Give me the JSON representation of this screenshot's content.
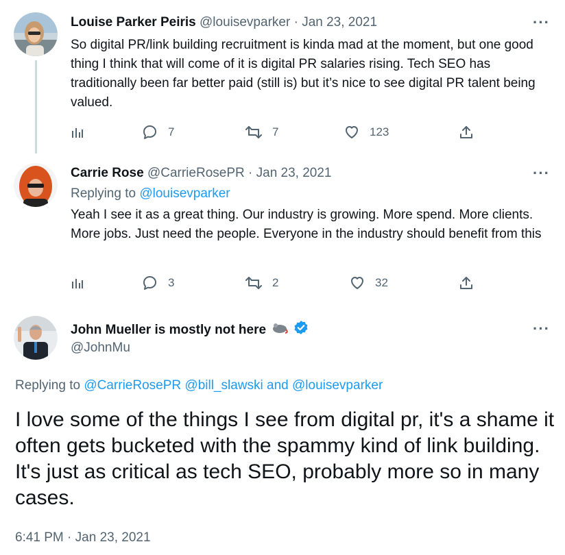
{
  "colors": {
    "accent": "#1d9bf0",
    "muted": "#536471",
    "text": "#0f1419",
    "thread_line": "#cfd9de",
    "verified": "#1d9bf0"
  },
  "tweets": [
    {
      "author_name": "Louise Parker Peiris",
      "handle": "@louisevparker",
      "separator": "·",
      "date": "Jan 23, 2021",
      "more_label": "···",
      "text": "So digital PR/link building recruitment is kinda mad at the moment, but one good thing I think that will come of it is digital PR salaries rising. Tech SEO has traditionally been far better paid (still is) but it’s nice to see digital PR talent being valued.",
      "stats": {
        "replies": "7",
        "retweets": "7",
        "likes": "123"
      }
    },
    {
      "author_name": "Carrie Rose",
      "handle": "@CarrieRosePR",
      "separator": "·",
      "date": "Jan 23, 2021",
      "more_label": "···",
      "replying_prefix": "Replying to",
      "replying_to": "@louisevparker",
      "text": "Yeah I see it as a great thing. Our industry is growing. More spend. More clients. More jobs. Just need the people. Everyone in the industry should benefit from this",
      "stats": {
        "replies": "3",
        "retweets": "2",
        "likes": "32"
      }
    }
  ],
  "main_tweet": {
    "author_name": "John Mueller is mostly not here",
    "handle": "@JohnMu",
    "more_label": "···",
    "replying_prefix": "Replying to",
    "replying_mentions": [
      "@CarrieRosePR",
      "@bill_slawski",
      "@louisevparker"
    ],
    "replying_and": "and",
    "text": "I love some of the things I see from digital pr, it's a shame it often gets bucketed with the spammy kind of link building. It's just as critical as tech SEO, probably more so in many cases.",
    "time": "6:41 PM",
    "separator": "·",
    "date": "Jan 23, 2021"
  },
  "icons": {
    "analytics": "analytics-icon",
    "reply": "reply-icon",
    "retweet": "retweet-icon",
    "like": "heart-icon",
    "share": "share-icon",
    "verified": "verified-badge-icon",
    "emoji": "mouse-emoji-icon"
  }
}
